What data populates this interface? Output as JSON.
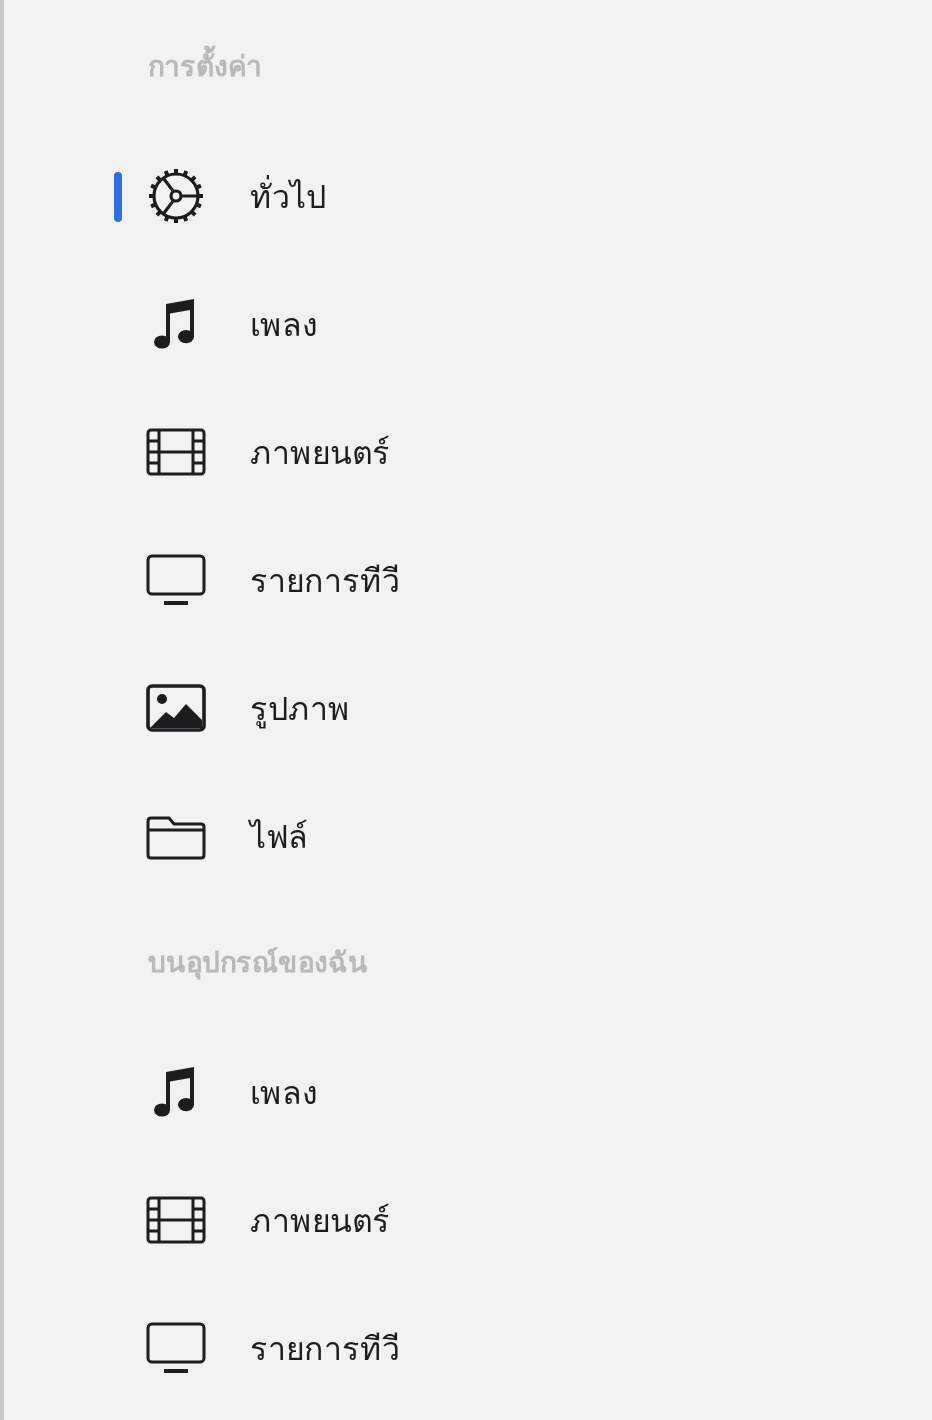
{
  "sections": [
    {
      "title": "การตั้งค่า",
      "items": [
        {
          "kind": "gear",
          "label": "ทั่วไป",
          "selected": true
        },
        {
          "kind": "music",
          "label": "เพลง",
          "selected": false
        },
        {
          "kind": "film",
          "label": "ภาพยนตร์",
          "selected": false
        },
        {
          "kind": "tv",
          "label": "รายการทีวี",
          "selected": false
        },
        {
          "kind": "photo",
          "label": "รูปภาพ",
          "selected": false
        },
        {
          "kind": "folder",
          "label": "ไฟล์",
          "selected": false
        }
      ]
    },
    {
      "title": "บนอุปกรณ์ของฉัน",
      "items": [
        {
          "kind": "music",
          "label": "เพลง",
          "selected": false
        },
        {
          "kind": "film",
          "label": "ภาพยนตร์",
          "selected": false
        },
        {
          "kind": "tv",
          "label": "รายการทีวี",
          "selected": false
        }
      ]
    }
  ]
}
